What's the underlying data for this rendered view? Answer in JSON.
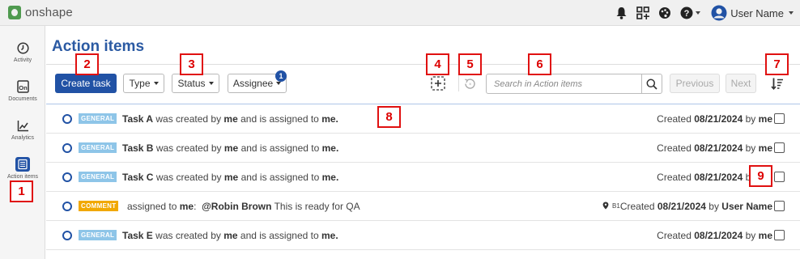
{
  "app": {
    "logo_text": "onshape"
  },
  "topbar": {
    "icons": [
      "bell-icon",
      "apps-grid-icon",
      "palette-icon",
      "help-icon"
    ],
    "user_name": "User Name"
  },
  "sidebar": {
    "items": [
      {
        "label": "Activity",
        "icon": "clock-icon",
        "active": false
      },
      {
        "label": "Documents",
        "icon": "onshape-doc-icon",
        "active": false
      },
      {
        "label": "Analytics",
        "icon": "chart-icon",
        "active": false
      },
      {
        "label": "Action items",
        "icon": "action-items-icon",
        "active": true
      }
    ]
  },
  "page": {
    "title": "Action items"
  },
  "toolbar": {
    "create_label": "Create task",
    "type_label": "Type",
    "status_label": "Status",
    "assignee_label": "Assignee",
    "assignee_count": "1",
    "search_placeholder": "Search in Action items",
    "previous_label": "Previous",
    "next_label": "Next"
  },
  "rows": [
    {
      "tag": "GENERAL",
      "task": "Task A",
      "t1": "was created by",
      "creator": "me",
      "t2": "and is assigned to",
      "assignee": "me.",
      "created_label": "Created",
      "date": "08/21/2024",
      "by": "by",
      "author": "me"
    },
    {
      "tag": "GENERAL",
      "task": "Task B",
      "t1": "was created by",
      "creator": "me",
      "t2": "and is assigned to",
      "assignee": "me.",
      "created_label": "Created",
      "date": "08/21/2024",
      "by": "by",
      "author": "me"
    },
    {
      "tag": "GENERAL",
      "task": "Task C",
      "t1": "was created by",
      "creator": "me",
      "t2": "and is assigned to",
      "assignee": "me.",
      "created_label": "Created",
      "date": "08/21/2024",
      "by": "by",
      "author": "me"
    },
    {
      "tag": "COMMENT",
      "pre": "assigned to",
      "assignee": "me",
      "colon": ":",
      "mention": "@Robin Brown",
      "message": "This is ready for QA",
      "pin_label": "B1",
      "created_label": "Created",
      "date": "08/21/2024",
      "by": "by",
      "author": "User Name"
    },
    {
      "tag": "GENERAL",
      "task": "Task E",
      "t1": "was created by",
      "creator": "me",
      "t2": "and is assigned to",
      "assignee": "me.",
      "created_label": "Created",
      "date": "08/21/2024",
      "by": "by",
      "author": "me"
    }
  ],
  "annotations": [
    "1",
    "2",
    "3",
    "4",
    "5",
    "6",
    "7",
    "8",
    "9"
  ],
  "colors": {
    "accent": "#2152a5",
    "title": "#2b5aa3",
    "general_tag": "#8ec5e8",
    "comment_tag": "#f1a800",
    "annotation": "#e01010"
  }
}
